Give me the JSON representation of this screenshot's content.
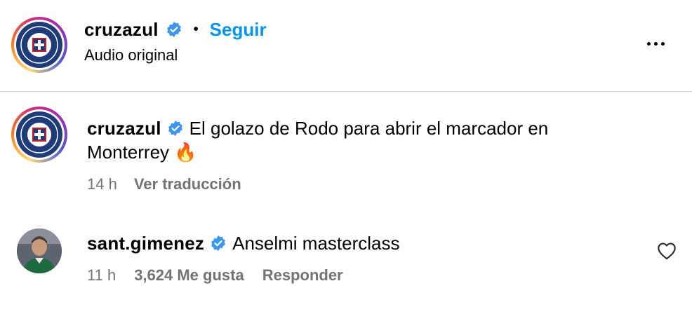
{
  "header": {
    "username": "cruzazul",
    "separator": "•",
    "follow_label": "Seguir",
    "subtitle": "Audio original"
  },
  "caption": {
    "username": "cruzazul",
    "text": "El golazo de Rodo para abrir el marcador en Monterrey 🔥",
    "time": "14 h",
    "translate_label": "Ver traducción"
  },
  "comment": {
    "username": "sant.gimenez",
    "text": "Anselmi masterclass",
    "time": "11 h",
    "likes": "3,624 Me gusta",
    "reply_label": "Responder"
  },
  "colors": {
    "verified": "#3897f0",
    "link": "#0095f6",
    "muted": "#737373",
    "club_blue": "#1f3c7a"
  }
}
